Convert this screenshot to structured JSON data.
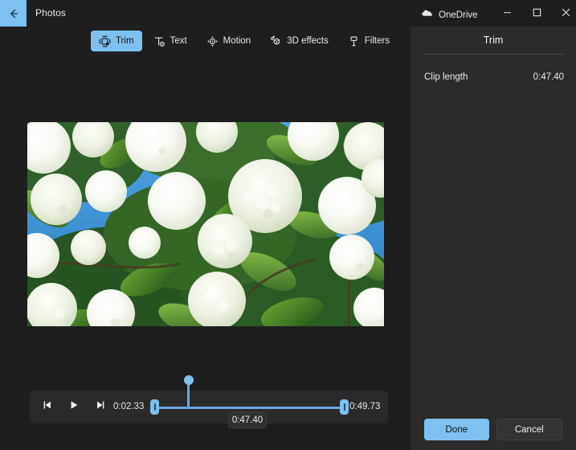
{
  "window": {
    "app_title": "Photos",
    "back_icon": "back-arrow-icon",
    "accent_color": "#7ec0ef",
    "background_color": "#1e1e1e",
    "panel_background_color": "#2b2b2b"
  },
  "toolbar": {
    "items": [
      {
        "label": "Trim",
        "icon": "trim-icon",
        "active": true
      },
      {
        "label": "Text",
        "icon": "text-icon",
        "active": false
      },
      {
        "label": "Motion",
        "icon": "motion-icon",
        "active": false
      },
      {
        "label": "3D effects",
        "icon": "three-d-effects-icon",
        "active": false
      },
      {
        "label": "Filters",
        "icon": "filters-icon",
        "active": false
      }
    ]
  },
  "preview": {
    "description": "White snowball viburnum flowers with green leaves against blue sky"
  },
  "timeline": {
    "prev_frame_icon": "previous-frame-icon",
    "play_icon": "play-icon",
    "next_frame_icon": "next-frame-icon",
    "start_time": "0:02.33",
    "end_time": "0:49.73",
    "playhead_tooltip": "0:47.40"
  },
  "panel": {
    "onedrive_label": "OneDrive",
    "onedrive_icon": "cloud-icon",
    "minimize_icon": "minimize-icon",
    "maximize_icon": "maximize-icon",
    "close_icon": "close-icon",
    "heading": "Trim",
    "clip_length_label": "Clip length",
    "clip_length_value": "0:47.40",
    "done_label": "Done",
    "cancel_label": "Cancel"
  }
}
